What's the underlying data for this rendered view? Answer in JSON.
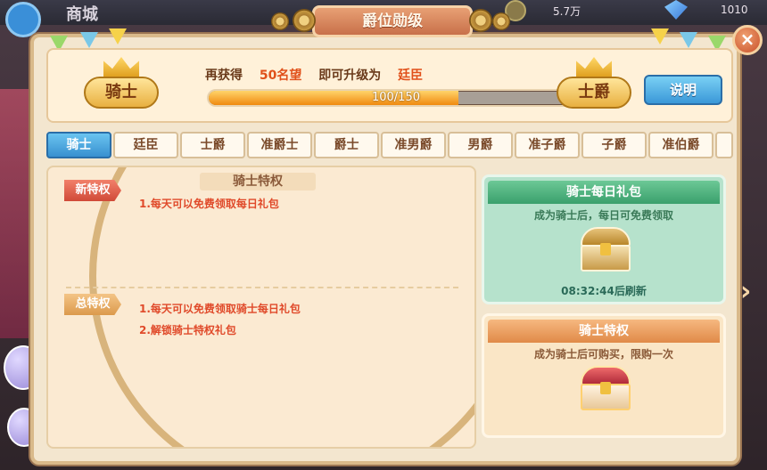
{
  "topbar": {
    "shop_label": "商城",
    "gold_amount": "5.7万",
    "gem_amount": "1010"
  },
  "dialog": {
    "title": "爵位勋级",
    "close_symbol": "×"
  },
  "rank": {
    "current": "骑士",
    "next": "士爵",
    "progress_prefix": "再获得",
    "progress_amount": "50名望",
    "progress_mid": "即可升级为",
    "progress_target": "廷臣",
    "progress_value": "100/150",
    "progress_fraction": 0.667,
    "explain_label": "说明"
  },
  "tabs": [
    "骑士",
    "廷臣",
    "士爵",
    "准爵士",
    "爵士",
    "准男爵",
    "男爵",
    "准子爵",
    "子爵",
    "准伯爵"
  ],
  "privileges": {
    "header": "骑士特权",
    "new_tag": "新特权",
    "new_items": [
      "1.每天可以免费领取每日礼包"
    ],
    "total_tag": "总特权",
    "total_items": [
      "1.每天可以免费领取骑士每日礼包",
      "2.解锁骑士特权礼包"
    ]
  },
  "cards": {
    "daily": {
      "title": "骑士每日礼包",
      "desc": "成为骑士后，每日可免费领取",
      "timer": "08:32:44后刷新"
    },
    "knight": {
      "title": "骑士特权",
      "desc": "成为骑士后可购买，限购一次"
    }
  },
  "next_arrow": "›",
  "colors": {
    "accent_blue": "#3890d0",
    "progress_orange": "#f08a10",
    "highlight_red": "#e04a2a"
  }
}
